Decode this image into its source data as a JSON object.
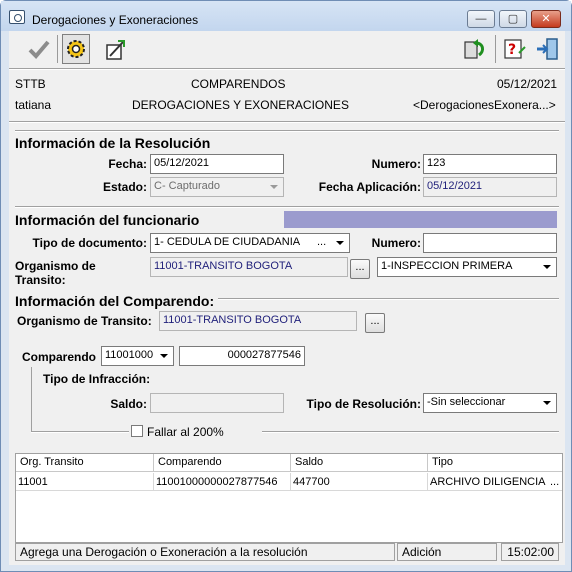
{
  "window": {
    "title": "Derogaciones y Exoneraciones",
    "minimize": "—",
    "maximize": "▢",
    "close": "✕"
  },
  "header": {
    "app": "STTB",
    "module": "COMPARENDOS",
    "date": "05/12/2021",
    "user": "tatiana",
    "screen": "DEROGACIONES Y EXONERACIONES",
    "form": "<DerogacionesExonera...>"
  },
  "resolucion": {
    "title": "Información de la Resolución",
    "fecha_label": "Fecha:",
    "fecha_value": "05/12/2021",
    "numero_label": "Numero:",
    "numero_value": "123",
    "estado_label": "Estado:",
    "estado_value": "C- Capturado",
    "fecha_aplicacion_label": "Fecha Aplicación:",
    "fecha_aplicacion_value": "05/12/2021"
  },
  "funcionario": {
    "title": "Información del funcionario",
    "tipo_doc_label": "Tipo de documento:",
    "tipo_doc_value": "1- CEDULA DE CIUDADANIA",
    "tipo_doc_more": "...",
    "numero_label": "Numero:",
    "numero_value": "",
    "organismo_label": "Organismo de Transito:",
    "organismo_value": "11001-TRANSITO BOGOTA",
    "organismo_btn": "...",
    "inspeccion_value": "1-INSPECCION PRIMERA"
  },
  "comparendo_info": {
    "title": "Información del Comparendo:",
    "organismo_label": "Organismo de Transito:",
    "organismo_value": "11001-TRANSITO BOGOTA",
    "organismo_btn": "...",
    "comparendo_label": "Comparendo",
    "comparendo_prefix": "11001000",
    "comparendo_number": "000027877546",
    "tipo_infraccion_label": "Tipo de Infracción:",
    "saldo_label": "Saldo:",
    "saldo_value": "",
    "tipo_resolucion_label": "Tipo de Resolución:",
    "tipo_resolucion_value": "-Sin seleccionar",
    "fallar_label": "Fallar al 200%"
  },
  "grid": {
    "columns": [
      "Org. Transito",
      "Comparendo",
      "Saldo",
      "Tipo"
    ],
    "rows": [
      [
        "11001",
        "11001000000027877546",
        "447700",
        "ARCHIVO DILIGENCIAS"
      ]
    ],
    "row_more": "..."
  },
  "statusbar": {
    "message": "Agrega una Derogación o Exoneración a la resolución",
    "mode": "Adición",
    "time": "15:02:00"
  },
  "icons": {
    "toolbar": [
      "check-icon",
      "settings-gear-icon",
      "export-edit-icon",
      "back-icon",
      "help-icon",
      "exit-door-icon"
    ]
  }
}
